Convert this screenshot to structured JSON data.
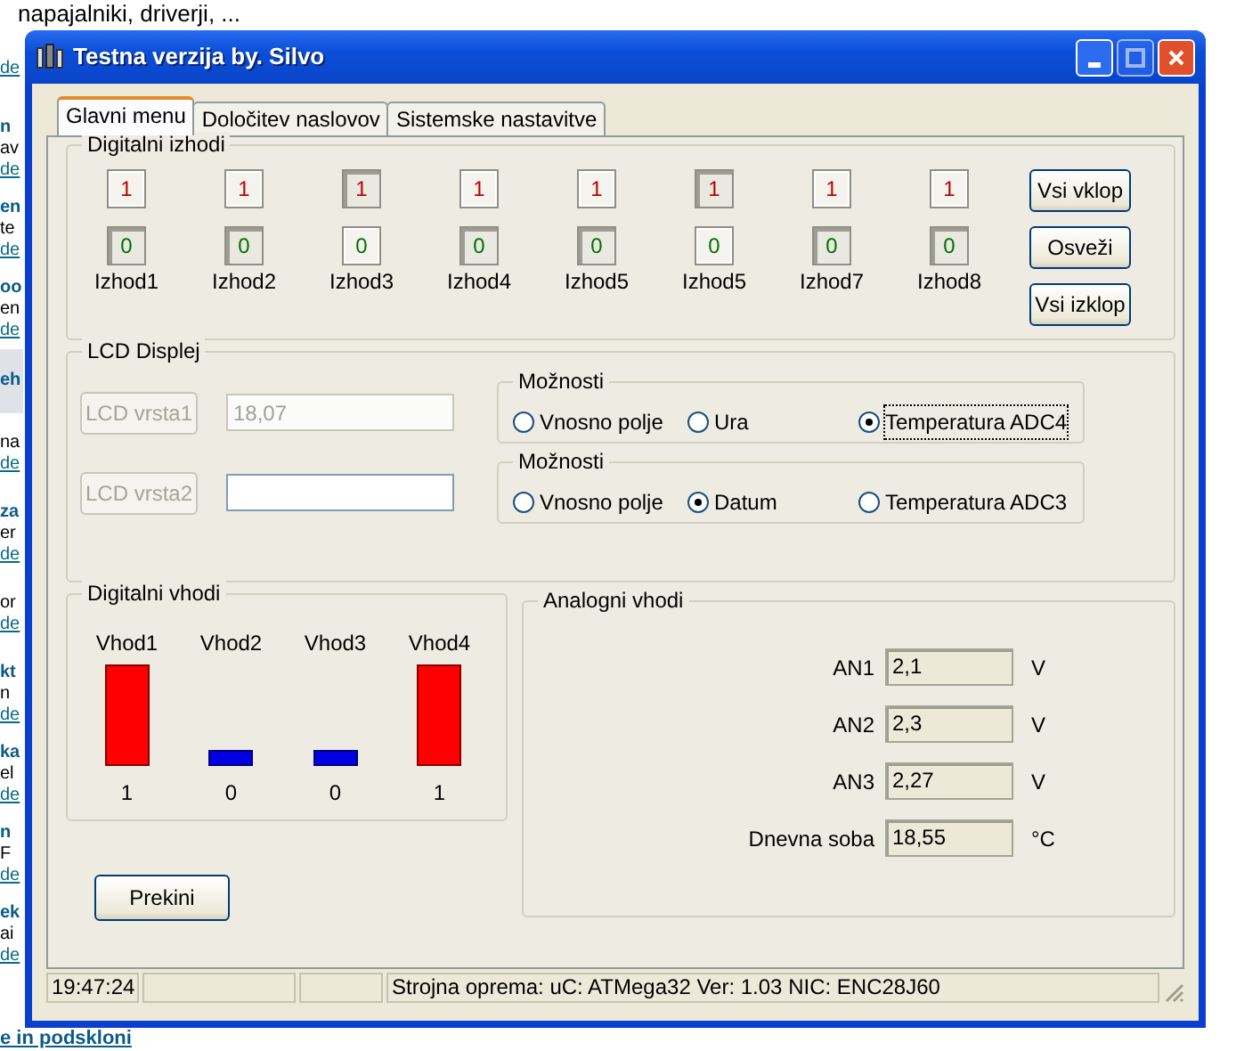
{
  "background_page": {
    "top_text": "napajalniki, driverji, ...",
    "blocks": [
      {
        "link": "de"
      },
      {
        "heading": "n",
        "text": "av",
        "link": "de"
      },
      {
        "heading": "en",
        "text": "te",
        "link": "de"
      },
      {
        "heading": "oo",
        "text": "en",
        "link": "de"
      },
      {
        "band": "eh"
      },
      {
        "text": "na",
        "link": "de"
      },
      {
        "heading": "za",
        "text": "er",
        "link": "de"
      },
      {
        "text": "or",
        "link": "de"
      },
      {
        "heading": "kt",
        "text": "n",
        "link": "de"
      },
      {
        "heading": "ka",
        "text": "el",
        "link": "de"
      },
      {
        "heading": "n",
        "text": "F",
        "link": "de"
      },
      {
        "heading": "ek",
        "text": "ai",
        "link": "de"
      }
    ],
    "bottom_heading": "e in podskloni"
  },
  "window": {
    "title": "Testna verzija by. Silvo"
  },
  "tabs": [
    {
      "label": "Glavni menu",
      "selected": true
    },
    {
      "label": "Določitev naslovov",
      "selected": false
    },
    {
      "label": "Sistemske nastavitve",
      "selected": false
    }
  ],
  "digital_outputs": {
    "title": "Digitalni izhodi",
    "outputs": [
      {
        "label": "Izhod1",
        "on_text": "1",
        "off_text": "0",
        "on": false
      },
      {
        "label": "Izhod2",
        "on_text": "1",
        "off_text": "0",
        "on": false
      },
      {
        "label": "Izhod3",
        "on_text": "1",
        "off_text": "0",
        "on": true
      },
      {
        "label": "Izhod4",
        "on_text": "1",
        "off_text": "0",
        "on": false
      },
      {
        "label": "Izhod5",
        "on_text": "1",
        "off_text": "0",
        "on": false
      },
      {
        "label": "Izhod5",
        "on_text": "1",
        "off_text": "0",
        "on": true
      },
      {
        "label": "Izhod7",
        "on_text": "1",
        "off_text": "0",
        "on": false
      },
      {
        "label": "Izhod8",
        "on_text": "1",
        "off_text": "0",
        "on": false
      }
    ],
    "buttons": [
      "Vsi vklop",
      "Osveži",
      "Vsi izklop"
    ]
  },
  "lcd": {
    "title": "LCD Displej",
    "rows": [
      {
        "button": "LCD vrsta1",
        "button_disabled": true,
        "value": "18,07",
        "field_disabled": true,
        "options_title": "Možnosti",
        "options": [
          {
            "label": "Vnosno polje",
            "selected": false
          },
          {
            "label": "Ura",
            "selected": false
          },
          {
            "label": "Temperatura ADC4",
            "selected": true
          }
        ]
      },
      {
        "button": "LCD vrsta2",
        "button_disabled": true,
        "field_disabled": false,
        "options_title": "Možnosti",
        "options": [
          {
            "label": "Vnosno polje",
            "selected": false
          },
          {
            "label": "Datum",
            "selected": true
          },
          {
            "label": "Temperatura ADC3",
            "selected": false
          }
        ]
      }
    ]
  },
  "digital_inputs": {
    "title": "Digitalni vhodi",
    "inputs": [
      {
        "label": "Vhod1",
        "value": "1",
        "on": true
      },
      {
        "label": "Vhod2",
        "value": "0",
        "on": false
      },
      {
        "label": "Vhod3",
        "value": "0",
        "on": false
      },
      {
        "label": "Vhod4",
        "value": "1",
        "on": true
      }
    ]
  },
  "analog_inputs": {
    "title": "Analogni vhodi",
    "rows": [
      {
        "label": "AN1",
        "value": "2,1",
        "unit": "V"
      },
      {
        "label": "AN2",
        "value": "2,3",
        "unit": "V"
      },
      {
        "label": "AN3",
        "value": "2,27",
        "unit": "V"
      },
      {
        "label": "Dnevna soba",
        "value": "18,55",
        "unit": "°C"
      }
    ]
  },
  "stop_button": "Prekini",
  "status_bar": {
    "time": "19:47:24",
    "info": "Strojna oprema: uC: ATMega32  Ver: 1.03  NIC: ENC28J60"
  }
}
